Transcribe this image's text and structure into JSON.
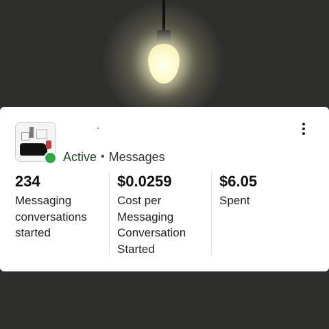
{
  "hero": {
    "image": "light-bulb-photo"
  },
  "ad": {
    "thumbnail": "ad-thumbnail-image",
    "status": "Active",
    "separator": "•",
    "type": "Messages",
    "status_color": "#2ea443"
  },
  "metrics": [
    {
      "value": "234",
      "label": "Messaging conversations started"
    },
    {
      "value": "$0.0259",
      "label": "Cost per Messaging Conversation Started"
    },
    {
      "value": "$6.05",
      "label": "Spent"
    }
  ],
  "icons": {
    "more": "more-vertical-icon"
  }
}
